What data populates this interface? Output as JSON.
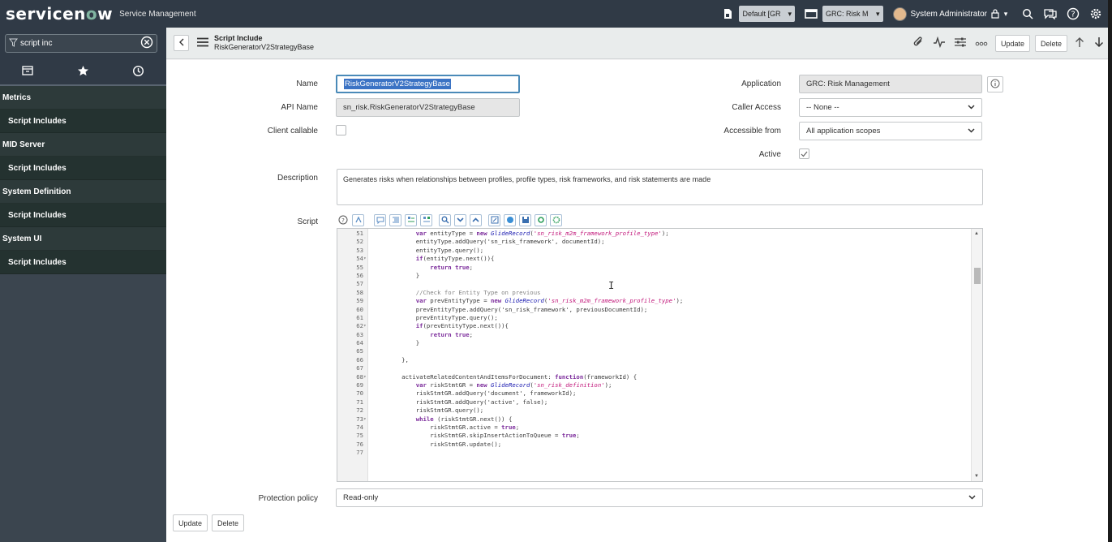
{
  "brand": {
    "logo_a": "servicen",
    "logo_o": "o",
    "logo_b": "w",
    "product": "Service Management"
  },
  "topbar": {
    "update_set": "Default [GR",
    "app_scope": "GRC: Risk M",
    "user": "System Administrator"
  },
  "sidebar": {
    "filter_value": "script inc",
    "items": [
      {
        "kind": "app",
        "label": "Metrics"
      },
      {
        "kind": "module",
        "label": "Script Includes"
      },
      {
        "kind": "app",
        "label": "MID Server"
      },
      {
        "kind": "module",
        "label": "Script Includes"
      },
      {
        "kind": "app",
        "label": "System Definition"
      },
      {
        "kind": "module",
        "label": "Script Includes"
      },
      {
        "kind": "app",
        "label": "System UI"
      },
      {
        "kind": "module",
        "label": "Script Includes"
      }
    ]
  },
  "header": {
    "table_label": "Script Include",
    "record_name": "RiskGeneratorV2StrategyBase",
    "update_label": "Update",
    "delete_label": "Delete"
  },
  "form": {
    "name_label": "Name",
    "name_value": "RiskGeneratorV2StrategyBase",
    "api_name_label": "API Name",
    "api_name_value": "sn_risk.RiskGeneratorV2StrategyBase",
    "client_callable_label": "Client callable",
    "application_label": "Application",
    "application_value": "GRC: Risk Management",
    "caller_access_label": "Caller Access",
    "caller_access_value": "-- None --",
    "accessible_from_label": "Accessible from",
    "accessible_from_value": "All application scopes",
    "active_label": "Active",
    "description_label": "Description",
    "description_value": "Generates risks when relationships between profiles, profile types, risk frameworks, and risk statements are made",
    "script_label": "Script",
    "protection_label": "Protection policy",
    "protection_value": "Read-only",
    "update_label": "Update",
    "delete_label": "Delete"
  },
  "code_lines": [
    {
      "n": "51",
      "fold": "",
      "html": "            <span class=\"kw\">var</span> entityType = <span class=\"kw\">new</span> <span class=\"ty\">GlideRecord</span>(<span class=\"str\">'sn_risk_m2m_framework_profile_type'</span>);"
    },
    {
      "n": "52",
      "fold": "",
      "html": "            entityType.addQuery('sn_risk_framework', documentId);"
    },
    {
      "n": "53",
      "fold": "",
      "html": "            entityType.query();"
    },
    {
      "n": "54",
      "fold": "▾",
      "html": "            <span class=\"kw\">if</span>(entityType.next()){"
    },
    {
      "n": "55",
      "fold": "",
      "html": "                <span class=\"kw\">return</span> <span class=\"kw\">true</span>;"
    },
    {
      "n": "56",
      "fold": "",
      "html": "            }"
    },
    {
      "n": "57",
      "fold": "",
      "html": ""
    },
    {
      "n": "58",
      "fold": "",
      "html": "            <span class=\"cm\">//Check for Entity Type on previous</span>"
    },
    {
      "n": "59",
      "fold": "",
      "html": "            <span class=\"kw\">var</span> prevEntityType = <span class=\"kw\">new</span> <span class=\"ty\">GlideRecord</span>(<span class=\"str\">'sn_risk_m2m_framework_profile_type'</span>);"
    },
    {
      "n": "60",
      "fold": "",
      "html": "            prevEntityType.addQuery('sn_risk_framework', previousDocumentId);"
    },
    {
      "n": "61",
      "fold": "",
      "html": "            prevEntityType.query();"
    },
    {
      "n": "62",
      "fold": "▾",
      "html": "            <span class=\"kw\">if</span>(prevEntityType.next()){"
    },
    {
      "n": "63",
      "fold": "",
      "html": "                <span class=\"kw\">return</span> <span class=\"kw\">true</span>;"
    },
    {
      "n": "64",
      "fold": "",
      "html": "            }"
    },
    {
      "n": "65",
      "fold": "",
      "html": ""
    },
    {
      "n": "66",
      "fold": "",
      "html": "        },"
    },
    {
      "n": "67",
      "fold": "",
      "html": ""
    },
    {
      "n": "68",
      "fold": "▾",
      "html": "        activateRelatedContentAndItemsForDocument: <span class=\"kw\">function</span>(frameworkId) {"
    },
    {
      "n": "69",
      "fold": "",
      "html": "            <span class=\"kw\">var</span> riskStmtGR = <span class=\"kw\">new</span> <span class=\"ty\">GlideRecord</span>(<span class=\"str\">'sn_risk_definition'</span>);"
    },
    {
      "n": "70",
      "fold": "",
      "html": "            riskStmtGR.addQuery('document', frameworkId);"
    },
    {
      "n": "71",
      "fold": "",
      "html": "            riskStmtGR.addQuery('active', false);"
    },
    {
      "n": "72",
      "fold": "",
      "html": "            riskStmtGR.query();"
    },
    {
      "n": "73",
      "fold": "▾",
      "html": "            <span class=\"kw\">while</span> (riskStmtGR.next()) {"
    },
    {
      "n": "74",
      "fold": "",
      "html": "                riskStmtGR.active = <span class=\"kw\">true</span>;"
    },
    {
      "n": "75",
      "fold": "",
      "html": "                riskStmtGR.skipInsertActionToQueue = <span class=\"kw\">true</span>;"
    },
    {
      "n": "76",
      "fold": "",
      "html": "                riskStmtGR.update();"
    },
    {
      "n": "77",
      "fold": "",
      "html": ""
    }
  ],
  "colors": {
    "topbar": "#303a46",
    "sidebar": "#3b454f",
    "module_bg": "#243230",
    "focus": "#4a8ab8"
  },
  "icons": [
    "filter-icon",
    "clear-icon",
    "archive-icon",
    "star-icon",
    "history-icon",
    "back-icon",
    "menu-icon",
    "attachment-icon",
    "activity-icon",
    "settings-sliders-icon",
    "more-icon",
    "up-arrow-icon",
    "down-arrow-icon",
    "info-icon",
    "search-icon",
    "chat-icon",
    "help-icon",
    "gear-icon"
  ]
}
